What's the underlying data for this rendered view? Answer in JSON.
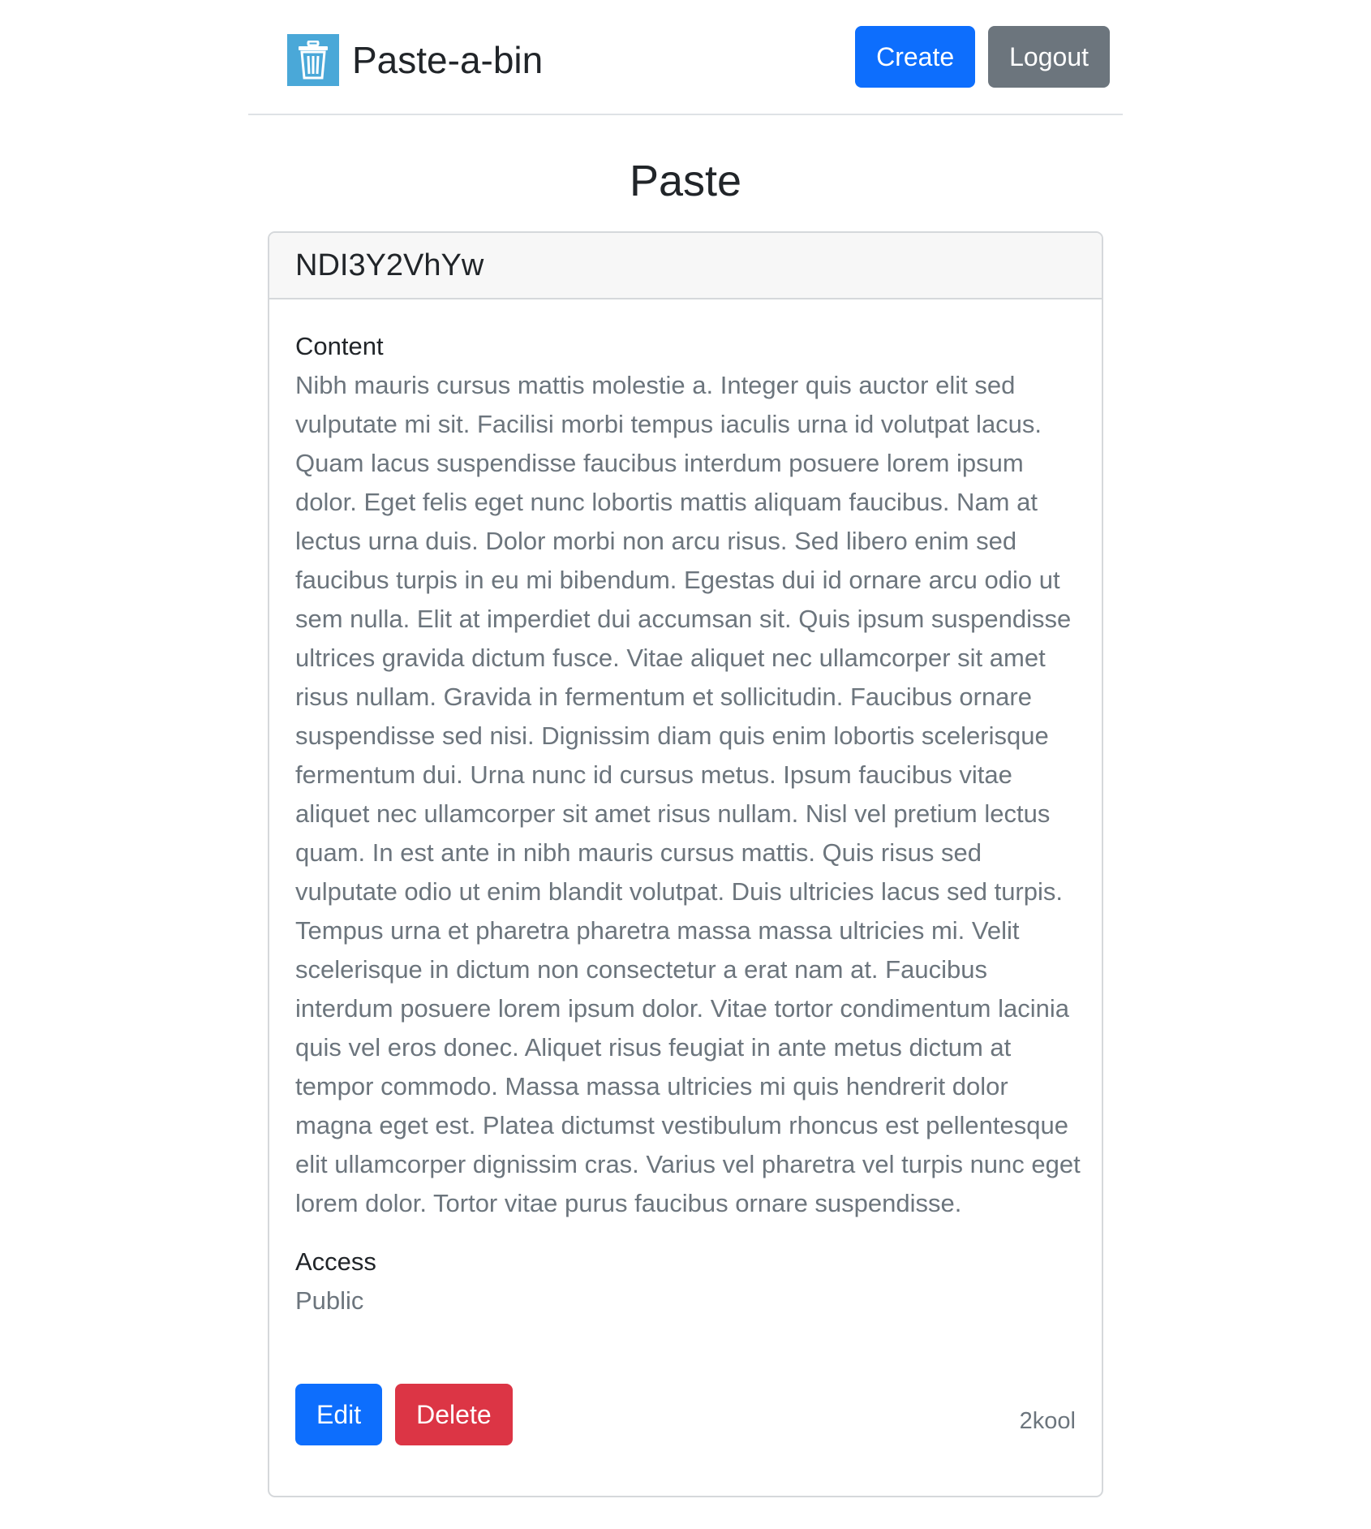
{
  "navbar": {
    "brand": "Paste-a-bin",
    "brand_icon": "trash-bin-icon",
    "create_label": "Create",
    "logout_label": "Logout"
  },
  "page": {
    "title": "Paste"
  },
  "paste": {
    "id": "NDI3Y2VhYw",
    "content_label": "Content",
    "content": "Nibh mauris cursus mattis molestie a. Integer quis auctor elit sed vulputate mi sit. Facilisi morbi tempus iaculis urna id volutpat lacus. Quam lacus suspendisse faucibus interdum posuere lorem ipsum dolor. Eget felis eget nunc lobortis mattis aliquam faucibus. Nam at lectus urna duis. Dolor morbi non arcu risus. Sed libero enim sed faucibus turpis in eu mi bibendum. Egestas dui id ornare arcu odio ut sem nulla. Elit at imperdiet dui accumsan sit. Quis ipsum suspendisse ultrices gravida dictum fusce. Vitae aliquet nec ullamcorper sit amet risus nullam. Gravida in fermentum et sollicitudin. Faucibus ornare suspendisse sed nisi. Dignissim diam quis enim lobortis scelerisque fermentum dui. Urna nunc id cursus metus. Ipsum faucibus vitae aliquet nec ullamcorper sit amet risus nullam. Nisl vel pretium lectus quam. In est ante in nibh mauris cursus mattis. Quis risus sed vulputate odio ut enim blandit volutpat. Duis ultricies lacus sed turpis. Tempus urna et pharetra pharetra massa massa ultricies mi. Velit scelerisque in dictum non consectetur a erat nam at. Faucibus interdum posuere lorem ipsum dolor. Vitae tortor condimentum lacinia quis vel eros donec. Aliquet risus feugiat in ante metus dictum at tempor commodo. Massa massa ultricies mi quis hendrerit dolor magna eget est. Platea dictumst vestibulum rhoncus est pellentesque elit ullamcorper dignissim cras. Varius vel pharetra vel turpis nunc eget lorem dolor. Tortor vitae purus faucibus ornare suspendisse.",
    "access_label": "Access",
    "access": "Public",
    "edit_label": "Edit",
    "delete_label": "Delete",
    "author": "2kool"
  },
  "colors": {
    "primary": "#0d6efd",
    "secondary": "#6c757d",
    "danger": "#dc3545",
    "brand_icon_bg": "#4aa8d8"
  }
}
